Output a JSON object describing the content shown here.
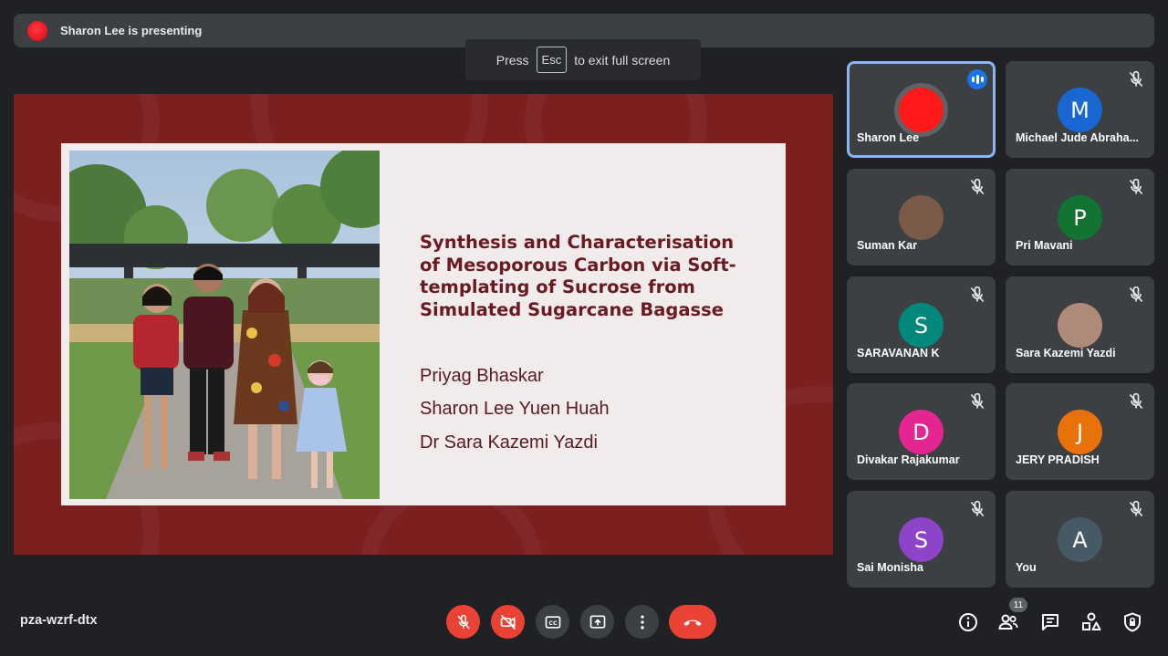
{
  "topbar": {
    "presenting_text": "Sharon Lee is presenting"
  },
  "esc_hint": {
    "prefix": "Press",
    "key": "Esc",
    "suffix": "to exit full screen"
  },
  "slide": {
    "title_lines": [
      "Synthesis and Characterisation",
      "of Mesoporous Carbon via Soft-",
      "templating of Sucrose from",
      "Simulated Sugarcane Bagasse"
    ],
    "authors": [
      "Priyag Bhaskar",
      "Sharon Lee Yuen Huah",
      "Dr Sara Kazemi Yazdi"
    ]
  },
  "participants": [
    {
      "name": "Sharon Lee",
      "initial": "",
      "color": "#ff1a1a",
      "active": true,
      "muted": false
    },
    {
      "name": "Michael Jude Abraha...",
      "initial": "M",
      "color": "#1967d2",
      "muted": true
    },
    {
      "name": "Suman Kar",
      "initial": "",
      "color": "#7a5a48",
      "muted": true
    },
    {
      "name": "Pri Mavani",
      "initial": "P",
      "color": "#137333",
      "muted": true
    },
    {
      "name": "SARAVANAN K",
      "initial": "S",
      "color": "#00897b",
      "muted": true
    },
    {
      "name": "Sara Kazemi Yazdi",
      "initial": "",
      "color": "#b08a78",
      "muted": true
    },
    {
      "name": "Divakar Rajakumar",
      "initial": "D",
      "color": "#e52592",
      "muted": true
    },
    {
      "name": "JERY PRADISH",
      "initial": "J",
      "color": "#e8710a",
      "muted": true
    },
    {
      "name": "Sai Monisha",
      "initial": "S",
      "color": "#8e44c8",
      "muted": true
    },
    {
      "name": "You",
      "initial": "A",
      "color": "#455a64",
      "muted": true
    }
  ],
  "bottombar": {
    "meeting_code": "pza-wzrf-dtx",
    "people_count": "11"
  },
  "colors": {
    "accent": "#8ab4f8",
    "danger": "#ea4335",
    "stage_bg": "#7b1f1f"
  }
}
